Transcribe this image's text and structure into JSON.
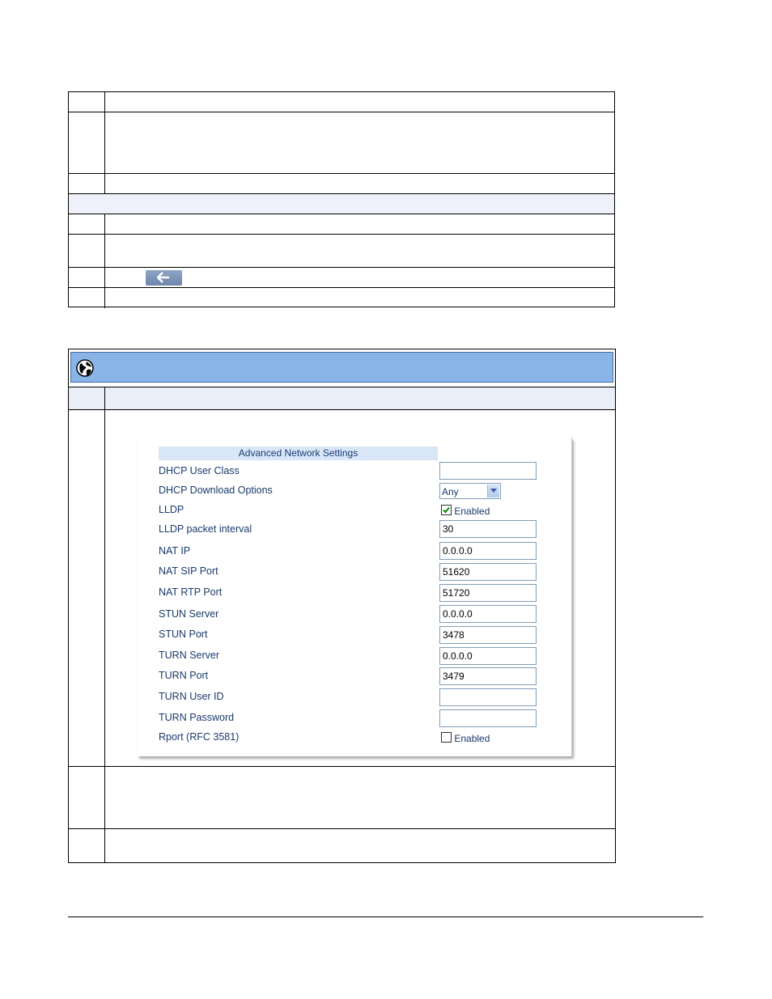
{
  "panel": {
    "title": "Advanced Network Settings",
    "fields": [
      {
        "label": "DHCP User Class",
        "value": ""
      },
      {
        "label": "DHCP Download Options",
        "value": "Any"
      },
      {
        "label": "LLDP",
        "checkbox_label": "Enabled",
        "checked": true
      },
      {
        "label": "LLDP packet interval",
        "value": "30"
      },
      {
        "label": "NAT IP",
        "value": "0.0.0.0"
      },
      {
        "label": "NAT SIP Port",
        "value": "51620"
      },
      {
        "label": "NAT RTP Port",
        "value": "51720"
      },
      {
        "label": "STUN Server",
        "value": "0.0.0.0"
      },
      {
        "label": "STUN Port",
        "value": "3478"
      },
      {
        "label": "TURN Server",
        "value": "0.0.0.0"
      },
      {
        "label": "TURN Port",
        "value": "3479"
      },
      {
        "label": "TURN User ID",
        "value": ""
      },
      {
        "label": "TURN Password",
        "value": ""
      },
      {
        "label": "Rport (RFC 3581)",
        "checkbox_label": "Enabled",
        "checked": false
      }
    ]
  },
  "icons": {
    "back": "back-arrow-icon",
    "globe": "globe-icon"
  },
  "colors": {
    "header_blue": "#88b4e8",
    "band": "#eef0fa",
    "panel_title_bg": "#d8e6f7"
  }
}
